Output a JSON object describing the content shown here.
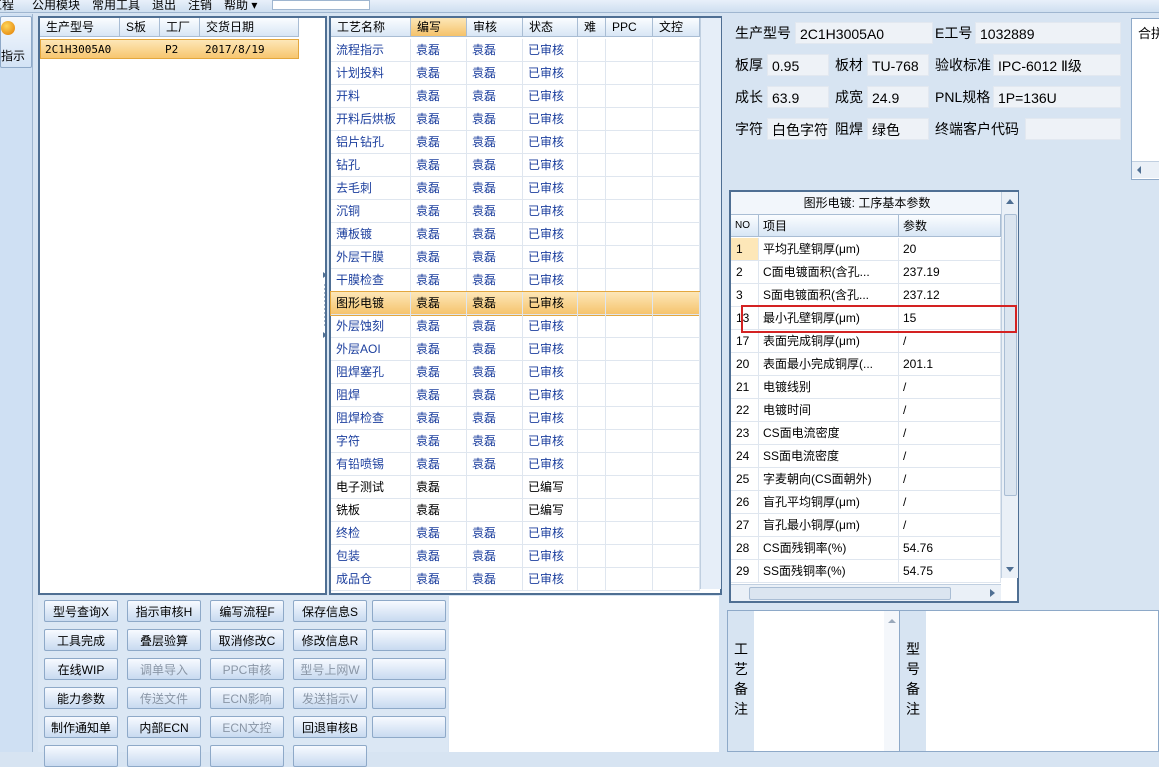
{
  "menubar": {
    "items": [
      "工程",
      "公用模块",
      "常用工具",
      "退出",
      "注销",
      "帮助 ▾"
    ]
  },
  "left": {
    "guide_label": "指示"
  },
  "orders": {
    "headers": [
      "生产型号",
      "S板",
      "工厂",
      "交货日期"
    ],
    "rows": [
      {
        "model": "2C1H3005A0",
        "s": "",
        "factory": "P2",
        "date": "2017/8/19"
      }
    ]
  },
  "process": {
    "headers": [
      "工艺名称",
      "编写",
      "审核",
      "状态",
      "难",
      "PPC",
      "文控"
    ],
    "rows": [
      {
        "name": "流程指示",
        "writer": "袁磊",
        "reviewer": "袁磊",
        "status": "已审核"
      },
      {
        "name": "计划投料",
        "writer": "袁磊",
        "reviewer": "袁磊",
        "status": "已审核"
      },
      {
        "name": "开料",
        "writer": "袁磊",
        "reviewer": "袁磊",
        "status": "已审核"
      },
      {
        "name": "开料后烘板",
        "writer": "袁磊",
        "reviewer": "袁磊",
        "status": "已审核"
      },
      {
        "name": "铝片钻孔",
        "writer": "袁磊",
        "reviewer": "袁磊",
        "status": "已审核"
      },
      {
        "name": "钻孔",
        "writer": "袁磊",
        "reviewer": "袁磊",
        "status": "已审核"
      },
      {
        "name": "去毛刺",
        "writer": "袁磊",
        "reviewer": "袁磊",
        "status": "已审核"
      },
      {
        "name": "沉铜",
        "writer": "袁磊",
        "reviewer": "袁磊",
        "status": "已审核"
      },
      {
        "name": "薄板镀",
        "writer": "袁磊",
        "reviewer": "袁磊",
        "status": "已审核"
      },
      {
        "name": "外层干膜",
        "writer": "袁磊",
        "reviewer": "袁磊",
        "status": "已审核"
      },
      {
        "name": "干膜检查",
        "writer": "袁磊",
        "reviewer": "袁磊",
        "status": "已审核"
      },
      {
        "name": "图形电镀",
        "writer": "袁磊",
        "reviewer": "袁磊",
        "status": "已审核"
      },
      {
        "name": "外层蚀刻",
        "writer": "袁磊",
        "reviewer": "袁磊",
        "status": "已审核"
      },
      {
        "name": "外层AOI",
        "writer": "袁磊",
        "reviewer": "袁磊",
        "status": "已审核"
      },
      {
        "name": "阻焊塞孔",
        "writer": "袁磊",
        "reviewer": "袁磊",
        "status": "已审核"
      },
      {
        "name": "阻焊",
        "writer": "袁磊",
        "reviewer": "袁磊",
        "status": "已审核"
      },
      {
        "name": "阻焊检查",
        "writer": "袁磊",
        "reviewer": "袁磊",
        "status": "已审核"
      },
      {
        "name": "字符",
        "writer": "袁磊",
        "reviewer": "袁磊",
        "status": "已审核"
      },
      {
        "name": "有铅喷锡",
        "writer": "袁磊",
        "reviewer": "袁磊",
        "status": "已审核"
      },
      {
        "name": "电子测试",
        "writer": "袁磊",
        "reviewer": "",
        "status": "已编写"
      },
      {
        "name": "铣板",
        "writer": "袁磊",
        "reviewer": "",
        "status": "已编写"
      },
      {
        "name": "终检",
        "writer": "袁磊",
        "reviewer": "袁磊",
        "status": "已审核"
      },
      {
        "name": "包装",
        "writer": "袁磊",
        "reviewer": "袁磊",
        "status": "已审核"
      },
      {
        "name": "成品仓",
        "writer": "袁磊",
        "reviewer": "袁磊",
        "status": "已审核"
      }
    ]
  },
  "buttons": {
    "row1": [
      "型号查询X",
      "指示审核H",
      "编写流程F",
      "保存信息S",
      ""
    ],
    "row2": [
      "工具完成",
      "叠层验算",
      "取消修改C",
      "修改信息R"
    ],
    "row3": [
      "在线WIP",
      "调单导入",
      "PPC审核",
      "型号上网W"
    ],
    "row4": [
      "能力参数",
      "传送文件",
      "ECN影响",
      "发送指示V"
    ],
    "row5": [
      "制作通知单",
      "内部ECN",
      "ECN文控",
      "回退审核B"
    ]
  },
  "info": {
    "model_label": "生产型号",
    "model_value": "2C1H3005A0",
    "e_label": "E工号",
    "e_value": "1032889",
    "thick_label": "板厚",
    "thick_value": "0.95",
    "mat_label": "板材",
    "mat_value": "TU-768",
    "std_label": "验收标准",
    "std_value": "IPC-6012 Ⅱ级",
    "len_label": "成长",
    "len_value": "63.9",
    "wid_label": "成宽",
    "wid_value": "24.9",
    "pnl_label": "PNL规格",
    "pnl_value": "1P=136U",
    "char_label": "字符",
    "char_value": "白色字符",
    "mask_label": "阻焊",
    "mask_value": "绿色",
    "cust_label": "终端客户代码",
    "cust_value": "",
    "side_label": "合拼"
  },
  "params": {
    "title": "图形电镀: 工序基本参数",
    "headers": [
      "NO",
      "项目",
      "参数"
    ],
    "rows": [
      {
        "no": "1",
        "item": "平均孔壁铜厚(μm)",
        "value": "20"
      },
      {
        "no": "2",
        "item": "C面电镀面积(含孔...",
        "value": "237.19"
      },
      {
        "no": "3",
        "item": "S面电镀面积(含孔...",
        "value": "237.12"
      },
      {
        "no": "13",
        "item": "最小孔壁铜厚(μm)",
        "value": "15"
      },
      {
        "no": "17",
        "item": "表面完成铜厚(μm)",
        "value": "/"
      },
      {
        "no": "20",
        "item": "表面最小完成铜厚(...",
        "value": "201.1"
      },
      {
        "no": "21",
        "item": "电镀线别",
        "value": "/"
      },
      {
        "no": "22",
        "item": "电镀时间",
        "value": "/"
      },
      {
        "no": "23",
        "item": "CS面电流密度",
        "value": "/"
      },
      {
        "no": "24",
        "item": "SS面电流密度",
        "value": "/"
      },
      {
        "no": "25",
        "item": "字麦朝向(CS面朝外)",
        "value": "/"
      },
      {
        "no": "26",
        "item": "盲孔平均铜厚(μm)",
        "value": "/"
      },
      {
        "no": "27",
        "item": "盲孔最小铜厚(μm)",
        "value": "/"
      },
      {
        "no": "28",
        "item": "CS面残铜率(%)",
        "value": "54.76"
      },
      {
        "no": "29",
        "item": "SS面残铜率(%)",
        "value": "54.75"
      }
    ]
  },
  "remarks": {
    "process_label": "工艺备注",
    "model_label": "型号备注"
  }
}
